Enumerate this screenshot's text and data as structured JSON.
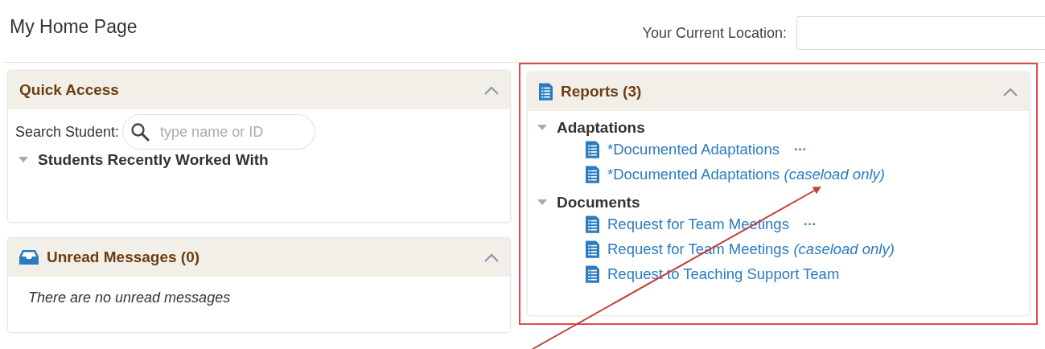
{
  "page": {
    "title": "My Home Page",
    "location_label": "Your Current Location:"
  },
  "quick_access": {
    "title": "Quick Access",
    "expanded": true,
    "search_label": "Search Student:",
    "search_placeholder": "type name or ID",
    "groups": [
      {
        "label": "Students Recently Worked With",
        "expanded": true
      }
    ]
  },
  "messages": {
    "title": "Unread Messages (0)",
    "expanded": true,
    "empty_text": "There are no unread messages"
  },
  "reports": {
    "title": "Reports (3)",
    "expanded": true,
    "highlighted": true,
    "groups": [
      {
        "label": "Adaptations",
        "expanded": true,
        "items": [
          {
            "label": "*Documented Adaptations",
            "menu": "···"
          },
          {
            "label": "*Documented Adaptations",
            "note": "(caseload only)"
          }
        ]
      },
      {
        "label": "Documents",
        "expanded": true,
        "items": [
          {
            "label": "Request for Team Meetings",
            "menu": "···"
          },
          {
            "label": "Request for Team Meetings",
            "note": "(caseload only)"
          },
          {
            "label": "Request to Teaching Support Team"
          }
        ]
      }
    ]
  }
}
